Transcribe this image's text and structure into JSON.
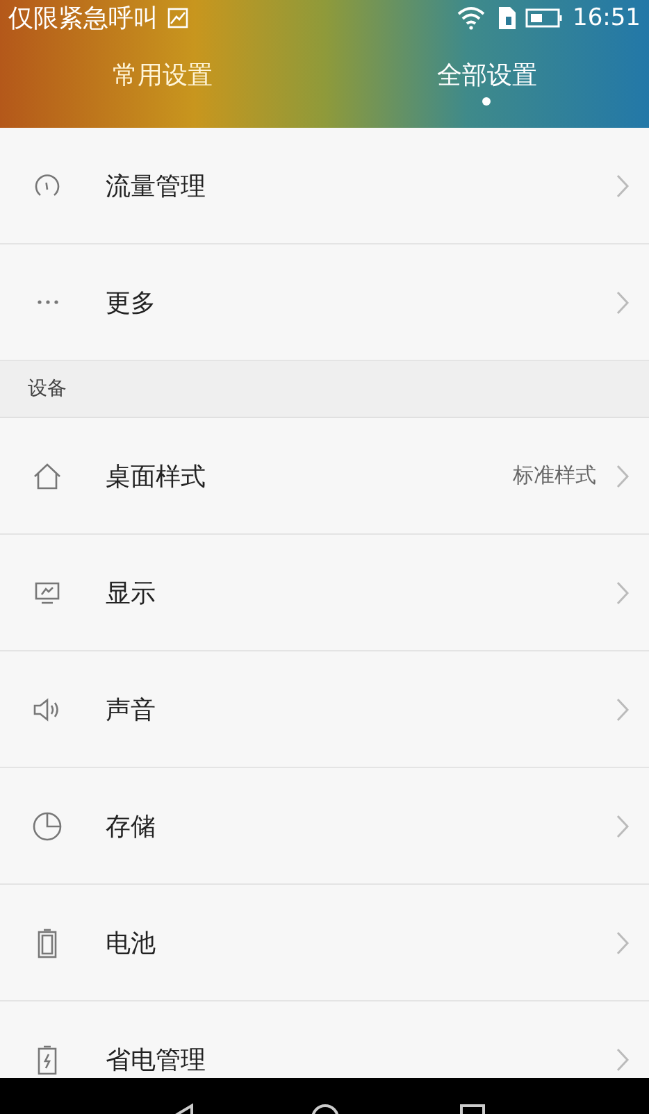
{
  "status_bar": {
    "carrier": "仅限紧急呼叫",
    "time": "16:51"
  },
  "tabs": [
    {
      "label": "常用设置",
      "selected": false
    },
    {
      "label": "全部设置",
      "selected": true
    }
  ],
  "sections": [
    {
      "items": [
        {
          "label": "流量管理"
        },
        {
          "label": "更多"
        }
      ]
    },
    {
      "header": "设备",
      "items": [
        {
          "label": "桌面样式",
          "value": "标准样式"
        },
        {
          "label": "显示"
        },
        {
          "label": "声音"
        },
        {
          "label": "存储"
        },
        {
          "label": "电池"
        },
        {
          "label": "省电管理"
        }
      ]
    }
  ]
}
